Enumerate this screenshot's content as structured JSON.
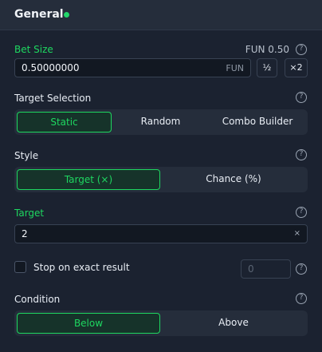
{
  "header": {
    "title": "General"
  },
  "bet_size": {
    "label": "Bet Size",
    "summary": "FUN 0.50",
    "value": "0.50000000",
    "currency": "FUN",
    "half_label": "½",
    "double_label": "×2"
  },
  "target_selection": {
    "label": "Target Selection",
    "options": [
      "Static",
      "Random",
      "Combo Builder"
    ],
    "selected": "Static"
  },
  "style": {
    "label": "Style",
    "options": [
      "Target (×)",
      "Chance (%)"
    ],
    "selected": "Target (×)"
  },
  "target": {
    "label": "Target",
    "value": "2",
    "clear": "×"
  },
  "stop_on_exact": {
    "label": "Stop on exact result",
    "checked": false,
    "placeholder": "0"
  },
  "condition": {
    "label": "Condition",
    "options": [
      "Below",
      "Above"
    ],
    "selected": "Below"
  },
  "icons": {
    "help": "?"
  },
  "colors": {
    "accent": "#1ed760",
    "background": "#1b2230",
    "header": "#252d3b"
  }
}
